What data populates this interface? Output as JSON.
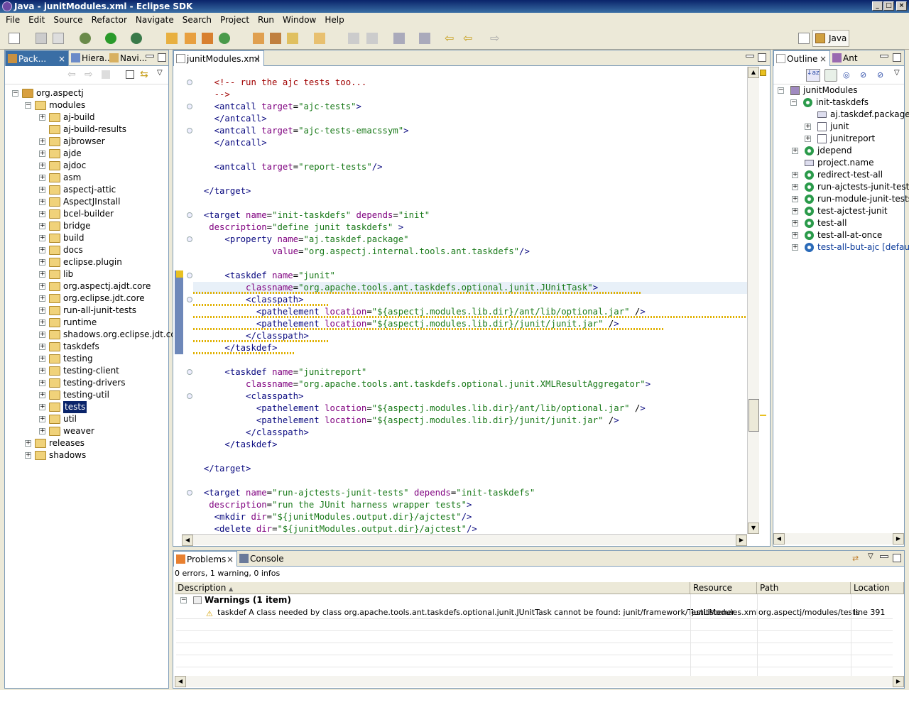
{
  "window": {
    "title": "Java - junitModules.xml - Eclipse SDK"
  },
  "menu": [
    "File",
    "Edit",
    "Source",
    "Refactor",
    "Navigate",
    "Search",
    "Project",
    "Run",
    "Window",
    "Help"
  ],
  "perspective": {
    "label": "Java"
  },
  "left_tabs": [
    "Pack...",
    "Hiera...",
    "Navi..."
  ],
  "package_tree": {
    "root": "org.aspectj",
    "modules": "modules",
    "children": [
      "aj-build",
      "aj-build-results",
      "ajbrowser",
      "ajde",
      "ajdoc",
      "asm",
      "aspectj-attic",
      "AspectJInstall",
      "bcel-builder",
      "bridge",
      "build",
      "docs",
      "eclipse.plugin",
      "lib",
      "org.aspectj.ajdt.core",
      "org.eclipse.jdt.core",
      "run-all-junit-tests",
      "runtime",
      "shadows.org.eclipse.jdt.core",
      "taskdefs",
      "testing",
      "testing-client",
      "testing-drivers",
      "testing-util",
      "tests",
      "util",
      "weaver"
    ],
    "selected": "tests",
    "after": [
      "releases",
      "shadows"
    ]
  },
  "editor": {
    "tab": "junitModules.xml"
  },
  "outline": {
    "tabs": [
      "Outline",
      "Ant"
    ],
    "root": "junitModules",
    "init": "init-taskdefs",
    "init_children": [
      "aj.taskdef.package",
      "junit",
      "junitreport"
    ],
    "items": [
      "jdepend",
      "project.name",
      "redirect-test-all",
      "run-ajctests-junit-tests",
      "run-module-junit-tests",
      "test-ajctest-junit",
      "test-all",
      "test-all-at-once"
    ],
    "default_item": "test-all-but-ajc [default]"
  },
  "problems": {
    "tabs": [
      "Problems",
      "Console"
    ],
    "summary": "0 errors, 1 warning, 0 infos",
    "columns": [
      "Description",
      "Resource",
      "Path",
      "Location"
    ],
    "group": "Warnings (1 item)",
    "row": {
      "description": "taskdef A class needed by class org.apache.tools.ant.taskdefs.optional.junit.JUnitTask cannot be found: junit/framework/TestListener",
      "resource": "junitModules.xml",
      "path": "org.aspectj/modules/tests",
      "location": "line 391"
    }
  },
  "code_lines": [
    {
      "i": "    ",
      "t": "<!-- run the ajc tests too...",
      "k": "cm"
    },
    {
      "i": "    ",
      "t": "-->",
      "k": "cm"
    },
    {
      "i": "    ",
      "t": "<antcall target=\"ajc-tests\">"
    },
    {
      "i": "    ",
      "t": "</antcall>"
    },
    {
      "i": "    ",
      "t": "<antcall target=\"ajc-tests-emacssym\">"
    },
    {
      "i": "    ",
      "t": "</antcall>"
    },
    {
      "i": "",
      "t": ""
    },
    {
      "i": "    ",
      "t": "<antcall target=\"report-tests\"/>"
    },
    {
      "i": "",
      "t": ""
    },
    {
      "i": "  ",
      "t": "</target>"
    },
    {
      "i": "",
      "t": ""
    },
    {
      "i": "  ",
      "t": "<target name=\"init-taskdefs\" depends=\"init\""
    },
    {
      "i": "   ",
      "t": "description=\"define junit taskdefs\" >"
    },
    {
      "i": "      ",
      "t": "<property name=\"aj.taskdef.package\""
    },
    {
      "i": "               ",
      "t": "value=\"org.aspectj.internal.tools.ant.taskdefs\"/>"
    },
    {
      "i": "",
      "t": ""
    },
    {
      "i": "      ",
      "t": "<taskdef name=\"junit\""
    },
    {
      "i": "          ",
      "t": "classname=\"org.apache.tools.ant.taskdefs.optional.junit.JUnitTask\">"
    },
    {
      "i": "          ",
      "t": "<classpath>"
    },
    {
      "i": "            ",
      "t": "<pathelement location=\"${aspectj.modules.lib.dir}/ant/lib/optional.jar\" />"
    },
    {
      "i": "            ",
      "t": "<pathelement location=\"${aspectj.modules.lib.dir}/junit/junit.jar\" />"
    },
    {
      "i": "          ",
      "t": "</classpath>"
    },
    {
      "i": "      ",
      "t": "</taskdef>"
    },
    {
      "i": "",
      "t": ""
    },
    {
      "i": "      ",
      "t": "<taskdef name=\"junitreport\""
    },
    {
      "i": "          ",
      "t": "classname=\"org.apache.tools.ant.taskdefs.optional.junit.XMLResultAggregator\">"
    },
    {
      "i": "          ",
      "t": "<classpath>"
    },
    {
      "i": "            ",
      "t": "<pathelement location=\"${aspectj.modules.lib.dir}/ant/lib/optional.jar\" />"
    },
    {
      "i": "            ",
      "t": "<pathelement location=\"${aspectj.modules.lib.dir}/junit/junit.jar\" />"
    },
    {
      "i": "          ",
      "t": "</classpath>"
    },
    {
      "i": "      ",
      "t": "</taskdef>"
    },
    {
      "i": "",
      "t": ""
    },
    {
      "i": "  ",
      "t": "</target>"
    },
    {
      "i": "",
      "t": ""
    },
    {
      "i": "  ",
      "t": "<target name=\"run-ajctests-junit-tests\" depends=\"init-taskdefs\""
    },
    {
      "i": "   ",
      "t": "description=\"run the JUnit harness wrapper tests\">"
    },
    {
      "i": "    ",
      "t": "<mkdir dir=\"${junitModules.output.dir}/ajctest\"/>"
    },
    {
      "i": "    ",
      "t": "<delete dir=\"${junitModules.output.dir}/ajctest\"/>"
    }
  ]
}
